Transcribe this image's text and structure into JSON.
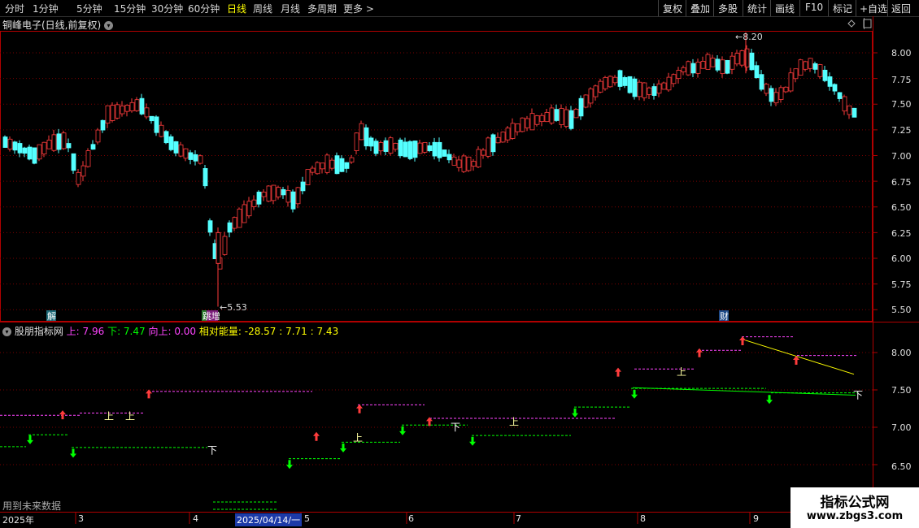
{
  "toolbar": {
    "left": [
      "分时",
      "1分钟",
      "5分钟",
      "15分钟",
      "30分钟",
      "60分钟",
      "日线",
      "周线",
      "月线",
      "多周期",
      "更多 >"
    ],
    "active_index": 6,
    "right": [
      "复权",
      "叠加",
      "多股",
      "统计",
      "画线",
      "F10",
      "标记",
      "+自选",
      "返回"
    ]
  },
  "stock": {
    "title": "铜峰电子(日线,前复权)",
    "high_label": "8.20",
    "low_label": "5.53"
  },
  "price_axis": [
    "8.00",
    "7.75",
    "7.50",
    "7.25",
    "7.00",
    "6.75",
    "6.50",
    "6.25",
    "6.00",
    "5.75",
    "5.50"
  ],
  "indicator": {
    "name": "股朋指标网",
    "items": [
      {
        "text": "上: 7.96",
        "color": "#ff44ff"
      },
      {
        "text": "下: 7.47",
        "color": "#00ff00"
      },
      {
        "text": "向上: 0.00",
        "color": "#ff44ff"
      },
      {
        "text": "相对能量: -28.57",
        "color": "#ffff00"
      },
      {
        "text": ": 7.71",
        "color": "#ffff00"
      },
      {
        "text": ": 7.43",
        "color": "#ffff00"
      }
    ],
    "axis": [
      "8.00",
      "7.50",
      "7.00",
      "6.50"
    ],
    "shang": "上",
    "xia": "下"
  },
  "markers": {
    "jie": "解",
    "zeng": "增",
    "cai": "财"
  },
  "future_note": "用到未来数据",
  "xaxis": [
    "2025年",
    "3",
    "4",
    "2025/04/14/一",
    "5",
    "6",
    "7",
    "8",
    "9"
  ],
  "watermark": {
    "line1": "指标公式网",
    "line2": "www.zbgs3.com"
  },
  "colors": {
    "up": "#ff3c3c",
    "down": "#54ffff",
    "magenta": "#ff44ff",
    "green": "#00ff00",
    "yellow": "#ffff00",
    "frame": "#b00000"
  }
}
